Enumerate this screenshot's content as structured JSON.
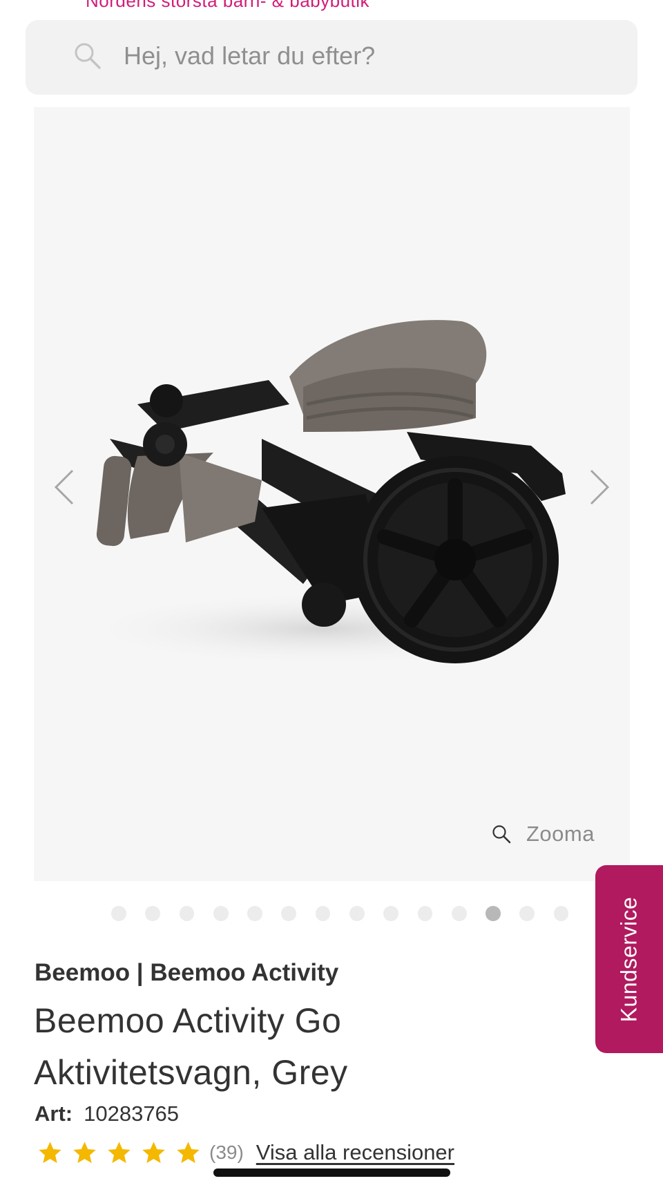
{
  "header": {
    "tagline": "Nordens största barn- & babybutik"
  },
  "search": {
    "placeholder": "Hej, vad letar du efter?",
    "icon": "search-icon"
  },
  "gallery": {
    "zoom_label": "Zooma",
    "slide_count": 14,
    "active_slide": 12,
    "prev_icon": "chevron-left-icon",
    "next_icon": "chevron-right-icon"
  },
  "side_tab": {
    "label": "Kundservice",
    "color": "#b11a5f"
  },
  "product": {
    "brand_line": "Beemoo | Beemoo Activity",
    "title": "Beemoo Activity Go Aktivitetsvagn, Grey",
    "art_label": "Art:",
    "art_number": "10283765",
    "rating": 5,
    "review_count": "(39)",
    "reviews_link": "Visa alla recensioner"
  },
  "colors": {
    "accent": "#d21d78",
    "star": "#f5b800",
    "search_bg": "#f2f2f2"
  }
}
